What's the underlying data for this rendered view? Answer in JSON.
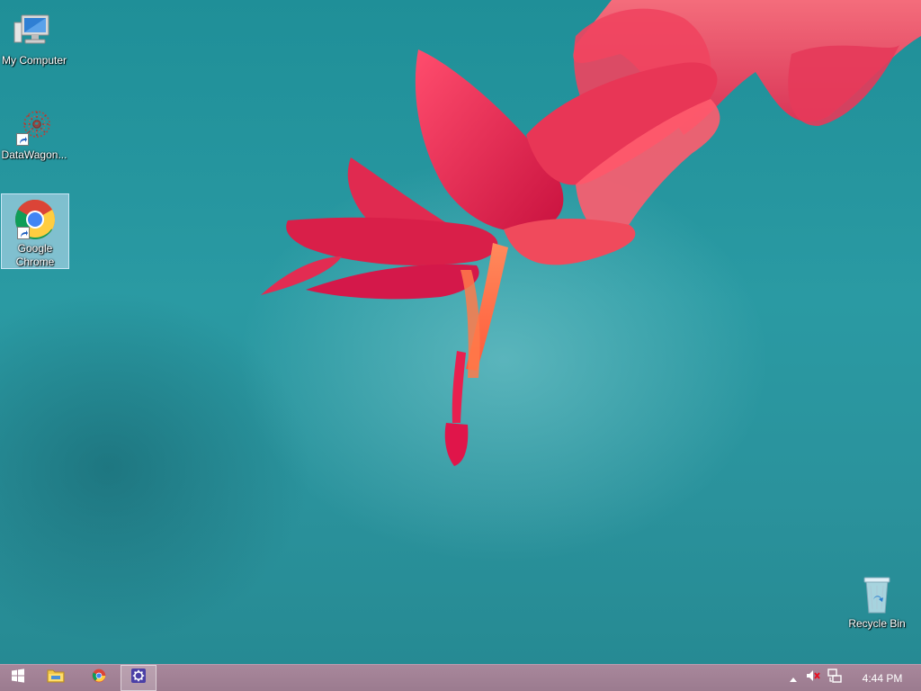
{
  "desktop": {
    "icons": [
      {
        "label": "My Computer",
        "icon": "computer-icon"
      },
      {
        "label": "DataWagon...",
        "icon": "datawagon-icon"
      },
      {
        "label": "Google Chrome",
        "icon": "chrome-icon",
        "selected": true
      },
      {
        "label": "Recycle Bin",
        "icon": "recycle-bin-icon"
      }
    ]
  },
  "taskbar": {
    "buttons": [
      {
        "icon": "windows-start-icon"
      },
      {
        "icon": "file-explorer-icon"
      },
      {
        "icon": "chrome-icon"
      },
      {
        "icon": "settings-gear-icon",
        "active": true
      }
    ],
    "tray": {
      "icons": [
        "show-hidden-icons-chevron",
        "volume-muted-icon",
        "network-icon"
      ],
      "clock": "4:44 PM"
    }
  },
  "colors": {
    "wallpaper_teal": "#2a9aa3",
    "flower_red": "#e0254f",
    "taskbar_mauve": "#a8879b"
  }
}
